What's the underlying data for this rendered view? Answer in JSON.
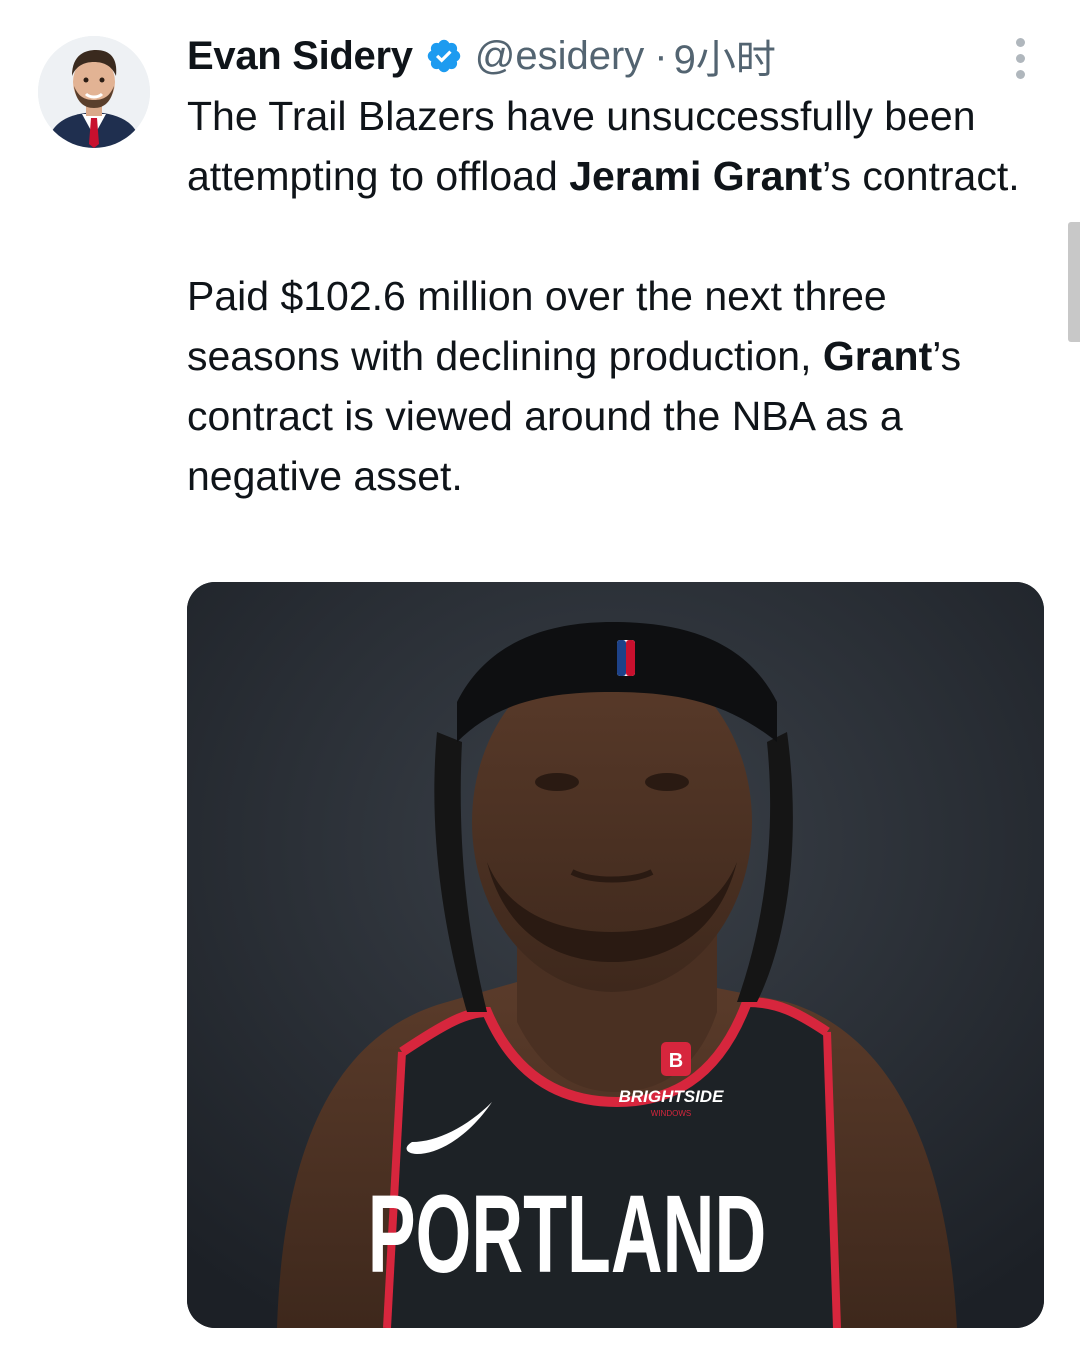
{
  "author": {
    "name": "Evan Sidery",
    "handle": "@esidery",
    "separator": "·",
    "time": "9小时",
    "verified_icon": "verified-badge-icon",
    "verified_color": "#1d9bf0"
  },
  "tweet": {
    "p1_a": "The Trail Blazers have unsuccessfully been attempting to offload ",
    "p1_bold": "Jerami Grant",
    "p1_b": "’s contract.",
    "p2_a": "Paid $102.6 million over the next three seasons with declining production, ",
    "p2_bold": "Grant",
    "p2_b": "’s contract is viewed around the NBA as a negative asset."
  },
  "media": {
    "jersey_sponsor": "BRIGHTSIDE",
    "jersey_sponsor_sub": "WINDOWS",
    "jersey_sponsor_logo": "B",
    "jersey_text": "PORTLAND"
  },
  "menu": {
    "icon": "more-dots-icon"
  }
}
